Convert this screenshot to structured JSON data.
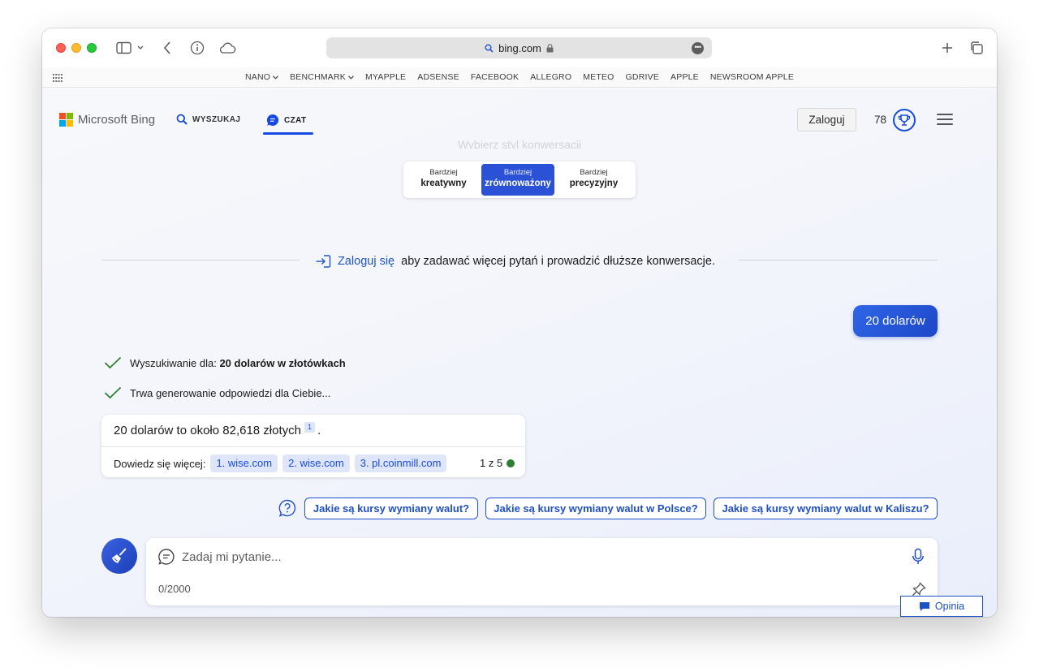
{
  "browser": {
    "url": "bing.com",
    "favorites": [
      {
        "label": "NANO",
        "dropdown": true
      },
      {
        "label": "BENCHMARK",
        "dropdown": true
      },
      {
        "label": "MYAPPLE",
        "dropdown": false
      },
      {
        "label": "ADSENSE",
        "dropdown": false
      },
      {
        "label": "FACEBOOK",
        "dropdown": false
      },
      {
        "label": "ALLEGRO",
        "dropdown": false
      },
      {
        "label": "METEO",
        "dropdown": false
      },
      {
        "label": "GDRIVE",
        "dropdown": false
      },
      {
        "label": "APPLE",
        "dropdown": false
      },
      {
        "label": "NEWSROOM APPLE",
        "dropdown": false
      }
    ]
  },
  "header": {
    "logo_text": "Microsoft Bing",
    "nav_search": "WYSZUKAJ",
    "nav_chat": "CZAT",
    "signin": "Zaloguj",
    "points": "78"
  },
  "tone": {
    "hint": "Wybierz styl konwersacji",
    "options": [
      {
        "top": "Bardziej",
        "bottom": "kreatywny",
        "active": false
      },
      {
        "top": "Bardziej",
        "bottom": "zrównoważony",
        "active": true
      },
      {
        "top": "Bardziej",
        "bottom": "precyzyjny",
        "active": false
      }
    ]
  },
  "login_prompt": {
    "link": "Zaloguj się",
    "text": "aby zadawać więcej pytań i prowadzić dłuższe konwersacje."
  },
  "user_message": "20 dolarów",
  "statuses": {
    "search_prefix": "Wyszukiwanie dla:",
    "search_query": "20 dolarów w złotówkach",
    "generating": "Trwa generowanie odpowiedzi dla Ciebie..."
  },
  "answer": {
    "text": "20 dolarów to około 82,618 złotych",
    "citation": "1",
    "period": ".",
    "learn_more": "Dowiedz się więcej:",
    "sources": [
      "1. wise.com",
      "2. wise.com",
      "3. pl.coinmill.com"
    ],
    "counter": "1 z 5"
  },
  "suggestions": [
    "Jakie są kursy wymiany walut?",
    "Jakie są kursy wymiany walut w Polsce?",
    "Jakie są kursy wymiany walut w Kaliszu?"
  ],
  "input": {
    "placeholder": "Zadaj mi pytanie...",
    "char_count": "0/2000"
  },
  "feedback": "Opinia",
  "colors": {
    "accent": "#174ae4",
    "status_check": "#2e7d32"
  }
}
